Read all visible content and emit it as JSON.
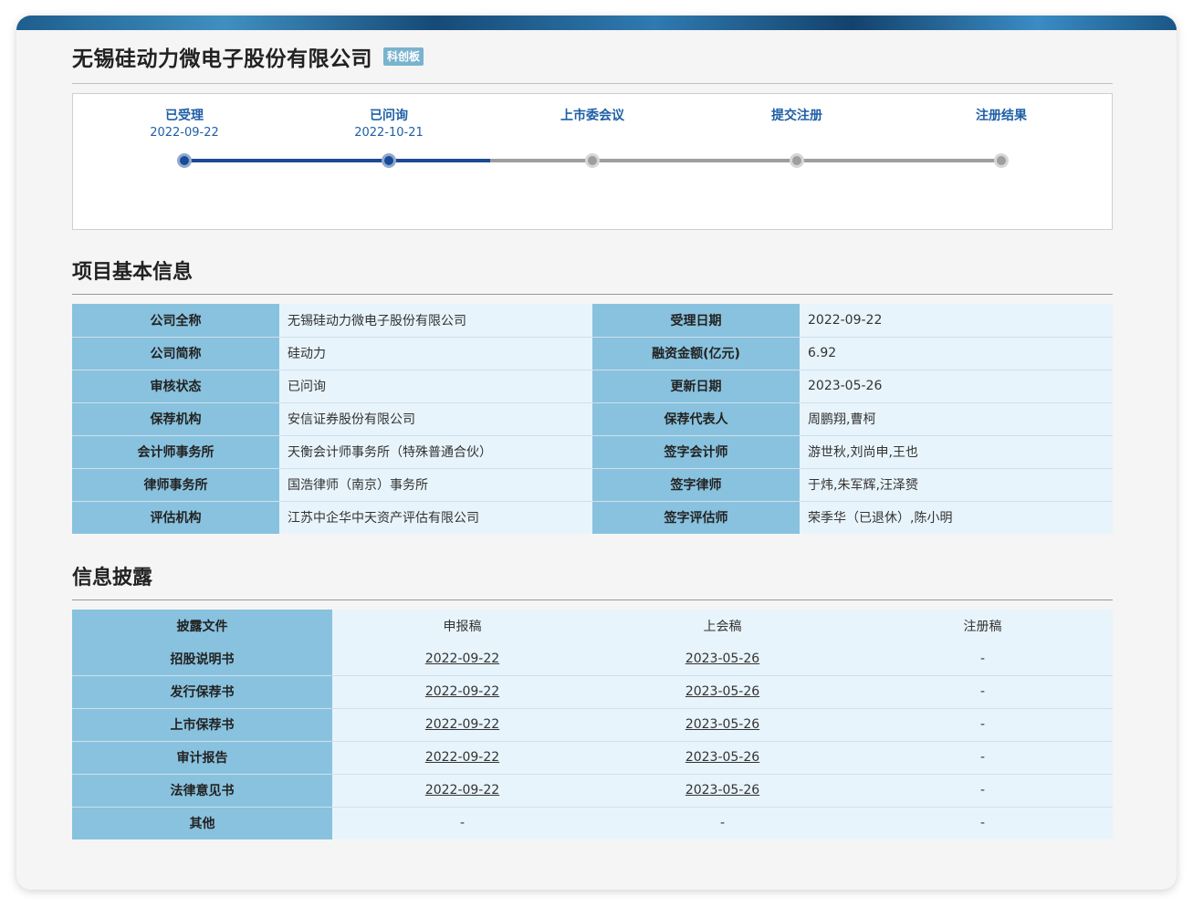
{
  "header": {
    "company_name": "无锡硅动力微电子股份有限公司",
    "board_badge": "科创板"
  },
  "progress": {
    "steps": [
      {
        "label": "已受理",
        "date": "2022-09-22",
        "status": "done"
      },
      {
        "label": "已问询",
        "date": "2022-10-21",
        "status": "done"
      },
      {
        "label": "上市委会议",
        "date": "",
        "status": "todo"
      },
      {
        "label": "提交注册",
        "date": "",
        "status": "todo"
      },
      {
        "label": "注册结果",
        "date": "",
        "status": "todo"
      }
    ]
  },
  "basic_info": {
    "title": "项目基本信息",
    "rows": [
      {
        "label1": "公司全称",
        "value1": "无锡硅动力微电子股份有限公司",
        "label2": "受理日期",
        "value2": "2022-09-22"
      },
      {
        "label1": "公司简称",
        "value1": "硅动力",
        "label2": "融资金额(亿元)",
        "value2": "6.92"
      },
      {
        "label1": "审核状态",
        "value1": "已问询",
        "label2": "更新日期",
        "value2": "2023-05-26"
      },
      {
        "label1": "保荐机构",
        "value1": "安信证券股份有限公司",
        "label2": "保荐代表人",
        "value2": "周鹏翔,曹柯"
      },
      {
        "label1": "会计师事务所",
        "value1": "天衡会计师事务所（特殊普通合伙）",
        "label2": "签字会计师",
        "value2": "游世秋,刘尚申,王也"
      },
      {
        "label1": "律师事务所",
        "value1": "国浩律师（南京）事务所",
        "label2": "签字律师",
        "value2": "于炜,朱军辉,汪泽赟"
      },
      {
        "label1": "评估机构",
        "value1": "江苏中企华中天资产评估有限公司",
        "label2": "签字评估师",
        "value2": "荣季华（已退休）,陈小明"
      }
    ]
  },
  "disclosure": {
    "title": "信息披露",
    "headers": [
      "披露文件",
      "申报稿",
      "上会稿",
      "注册稿"
    ],
    "rows": [
      {
        "name": "招股说明书",
        "declaration": "2022-09-22",
        "meeting": "2023-05-26",
        "registration": "-"
      },
      {
        "name": "发行保荐书",
        "declaration": "2022-09-22",
        "meeting": "2023-05-26",
        "registration": "-"
      },
      {
        "name": "上市保荐书",
        "declaration": "2022-09-22",
        "meeting": "2023-05-26",
        "registration": "-"
      },
      {
        "name": "审计报告",
        "declaration": "2022-09-22",
        "meeting": "2023-05-26",
        "registration": "-"
      },
      {
        "name": "法律意见书",
        "declaration": "2022-09-22",
        "meeting": "2023-05-26",
        "registration": "-"
      },
      {
        "name": "其他",
        "declaration": "-",
        "meeting": "-",
        "registration": "-"
      }
    ]
  },
  "colors": {
    "accent_blue": "#1a4b95",
    "label_bg": "#89c2de",
    "value_bg": "#e8f4fb",
    "badge_bg": "#79b4cf"
  }
}
